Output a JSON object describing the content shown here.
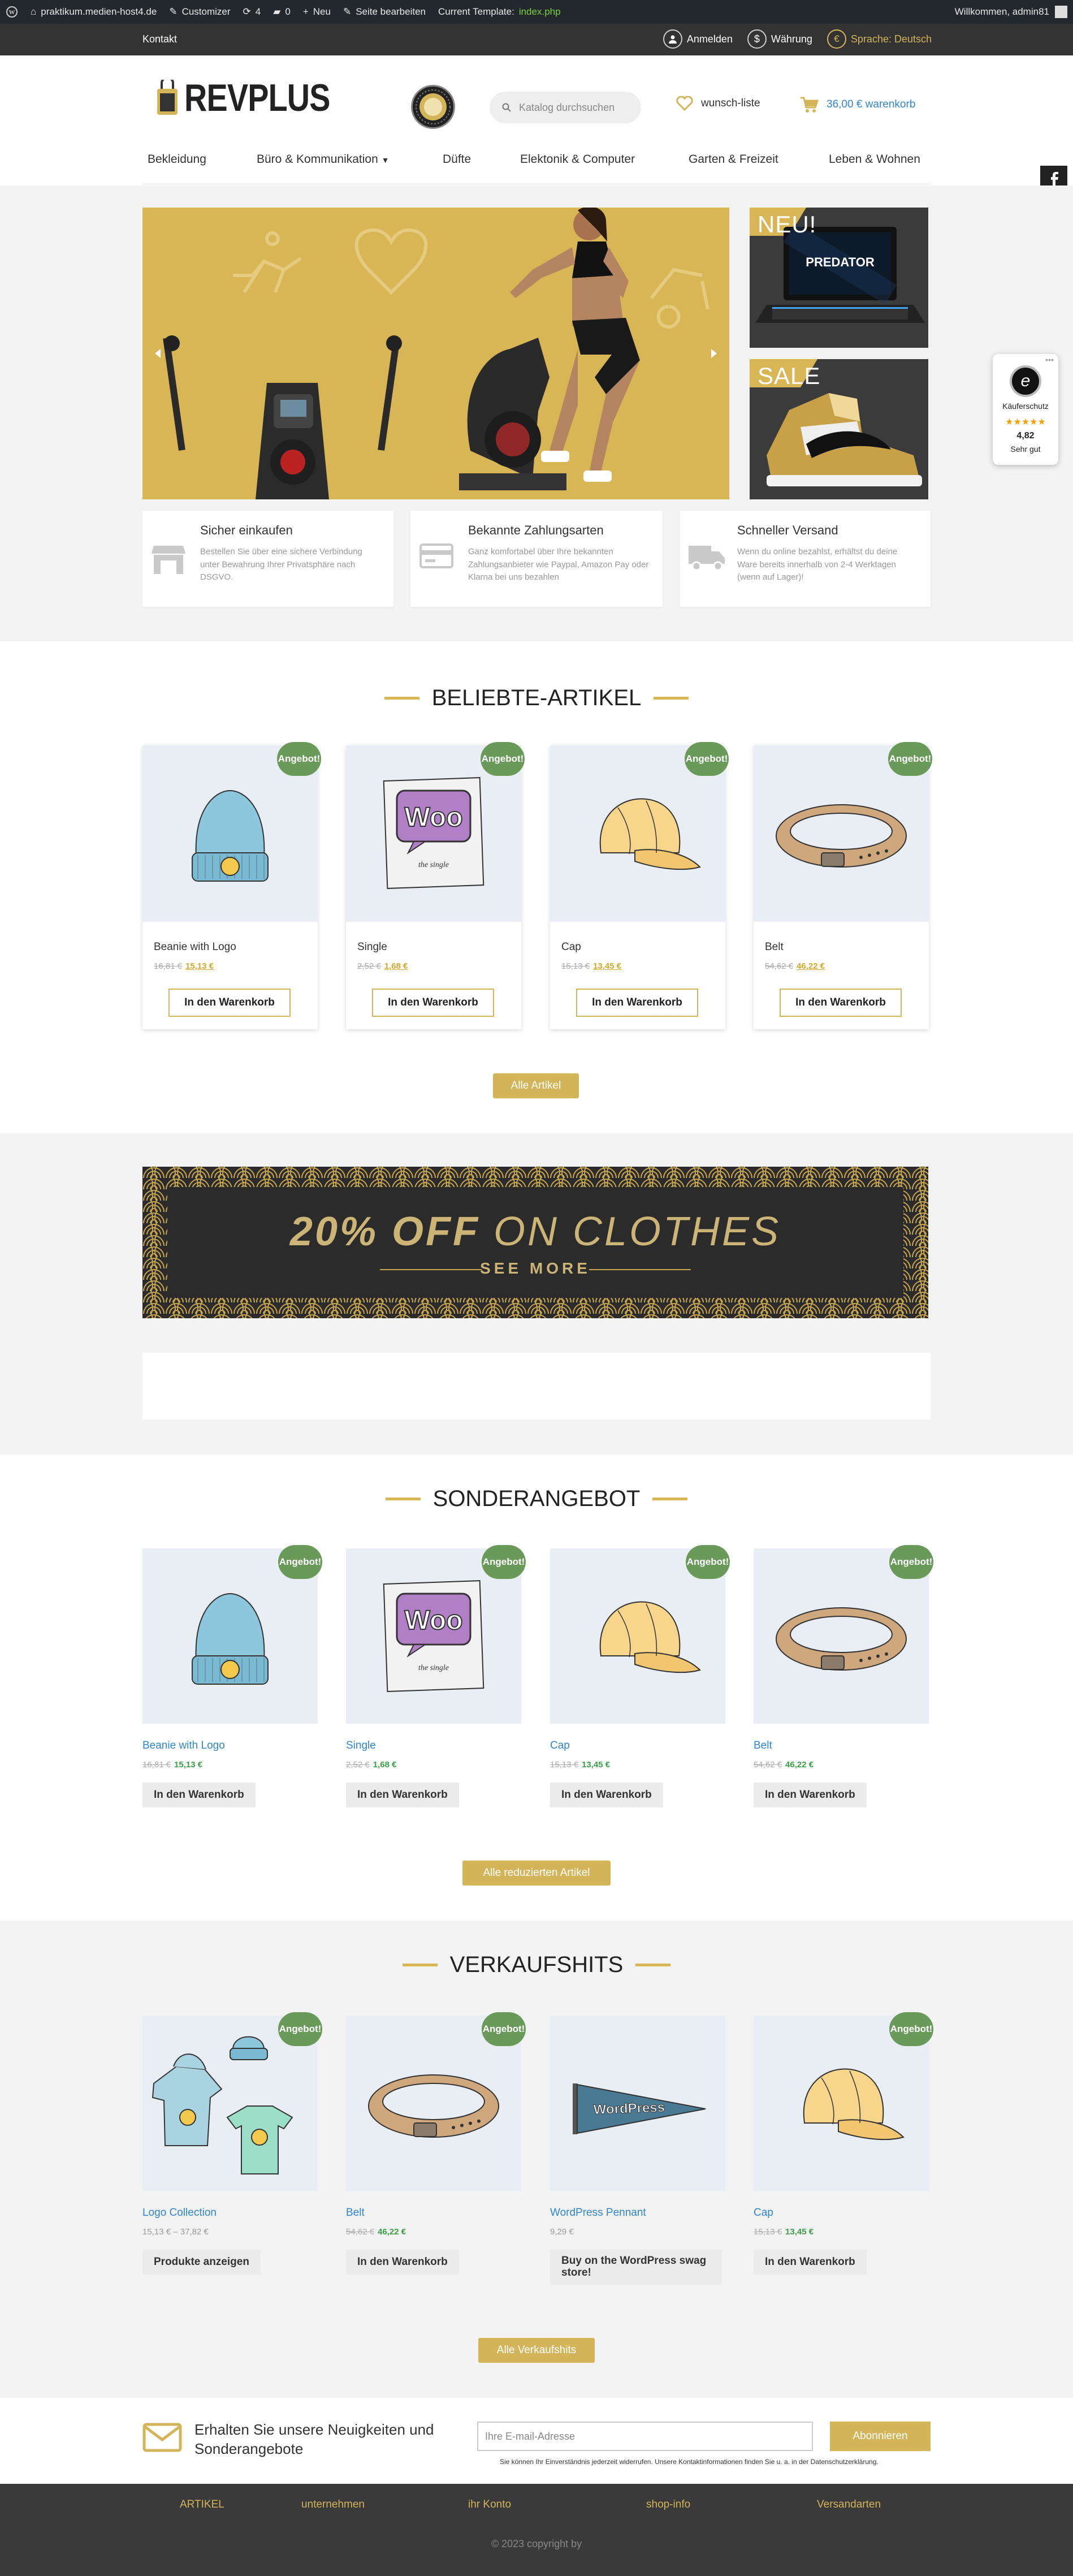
{
  "adminbar": {
    "site": "praktikum.medien-host4.de",
    "customizer": "Customizer",
    "updates": "4",
    "comments": "0",
    "new": "Neu",
    "edit": "Seite bearbeiten",
    "template_label": "Current Template:",
    "template_file": "index.php",
    "welcome": "Willkommen, admin81"
  },
  "topbar": {
    "contact": "Kontakt",
    "login": "Anmelden",
    "currency": "Währung",
    "language": "Sprache: Deutsch"
  },
  "header": {
    "logo": "REVPLUS",
    "search_placeholder": "Katalog durchsuchen",
    "wishlist": "wunsch-liste",
    "cart": "36,00 € warenkorb"
  },
  "nav": [
    "Bekleidung",
    "Büro & Kommunikation",
    "Düfte",
    "Elektonik & Computer",
    "Garten & Freizeit",
    "Leben & Wohnen"
  ],
  "hero": {
    "side_top_label": "NEU!",
    "side_top_brand": "PREDATOR",
    "side_bottom_label": "SALE"
  },
  "features": [
    {
      "title": "Sicher einkaufen",
      "text": "Bestellen Sie über eine sichere Verbindung unter Bewahrung Ihrer Privatsphäre nach DSGVO."
    },
    {
      "title": "Bekannte Zahlungsarten",
      "text": "Ganz komfortabel über Ihre bekannten Zahlungsanbieter wie Paypal, Amazon Pay oder Klarna bei uns bezahlen"
    },
    {
      "title": "Schneller Versand",
      "text": "Wenn du online bezahlst, erhältst du deine Ware bereits innerhalb von 2-4 Werktagen (wenn auf Lager)!"
    }
  ],
  "trusted": {
    "label": "Käuferschutz",
    "score": "4,82",
    "grade": "Sehr gut",
    "stars": "★★★★★"
  },
  "beliebte": {
    "title": "BELIEBTE-ARTIKEL",
    "sale_badge": "Angebot!",
    "products": [
      {
        "name": "Beanie with Logo",
        "old": "16,81 €",
        "new": "15,13 €",
        "button": "In den Warenkorb",
        "icon": "beanie"
      },
      {
        "name": "Single",
        "old": "2,52 €",
        "new": "1,68 €",
        "button": "In den Warenkorb",
        "icon": "woo-single"
      },
      {
        "name": "Cap",
        "old": "15,13 €",
        "new": "13,45 €",
        "button": "In den Warenkorb",
        "icon": "cap"
      },
      {
        "name": "Belt",
        "old": "54,62 €",
        "new": "46,22 €",
        "button": "In den Warenkorb",
        "icon": "belt"
      }
    ],
    "all_button": "Alle Artikel"
  },
  "promo": {
    "main_bold": "20% OFF",
    "main_light": "ON CLOTHES",
    "sub": "SEE MORE"
  },
  "sonder": {
    "title": "SONDERANGEBOT",
    "sale_badge": "Angebot!",
    "products": [
      {
        "name": "Beanie with Logo",
        "old": "16,81 €",
        "new": "15,13 €",
        "button": "In den Warenkorb",
        "icon": "beanie"
      },
      {
        "name": "Single",
        "old": "2,52 €",
        "new": "1,68 €",
        "button": "In den Warenkorb",
        "icon": "woo-single"
      },
      {
        "name": "Cap",
        "old": "15,13 €",
        "new": "13,45 €",
        "button": "In den Warenkorb",
        "icon": "cap"
      },
      {
        "name": "Belt",
        "old": "54,62 €",
        "new": "46,22 €",
        "button": "In den Warenkorb",
        "icon": "belt"
      }
    ],
    "all_button": "Alle reduzierten Artikel"
  },
  "hits": {
    "title": "VERKAUFSHITS",
    "sale_badge": "Angebot!",
    "products": [
      {
        "name": "Logo Collection",
        "price_range": "15,13 € – 37,82 €",
        "button": "Produkte anzeigen",
        "icon": "logo-collection"
      },
      {
        "name": "Belt",
        "old": "54,62 €",
        "new": "46,22 €",
        "button": "In den Warenkorb",
        "icon": "belt"
      },
      {
        "name": "WordPress Pennant",
        "price": "9,29 €",
        "button": "Buy on the WordPress swag store!",
        "icon": "pennant"
      },
      {
        "name": "Cap",
        "old": "15,13 €",
        "new": "13,45 €",
        "button": "In den Warenkorb",
        "icon": "cap"
      }
    ],
    "pennant_text": "WordPress",
    "all_button": "Alle Verkaufshits"
  },
  "newsletter": {
    "title": "Erhalten Sie unsere Neuigkeiten und Sonderangebote",
    "placeholder": "Ihre E-mail-Adresse",
    "button": "Abonnieren",
    "note": "Sie können Ihr Einverständnis jederzeit widerrufen. Unsere Kontaktinformationen finden Sie u. a. in der Datenschutzerklärung."
  },
  "footer": {
    "links": [
      "ARTIKEL",
      "unternehmen",
      "ihr Konto",
      "shop-info",
      "Versandarten"
    ],
    "copyright": "© 2023 copyright by"
  },
  "colors": {
    "accent": "#d3b458",
    "sale": "#6a9a5a",
    "link": "#2f86d4",
    "dark": "#333333"
  }
}
